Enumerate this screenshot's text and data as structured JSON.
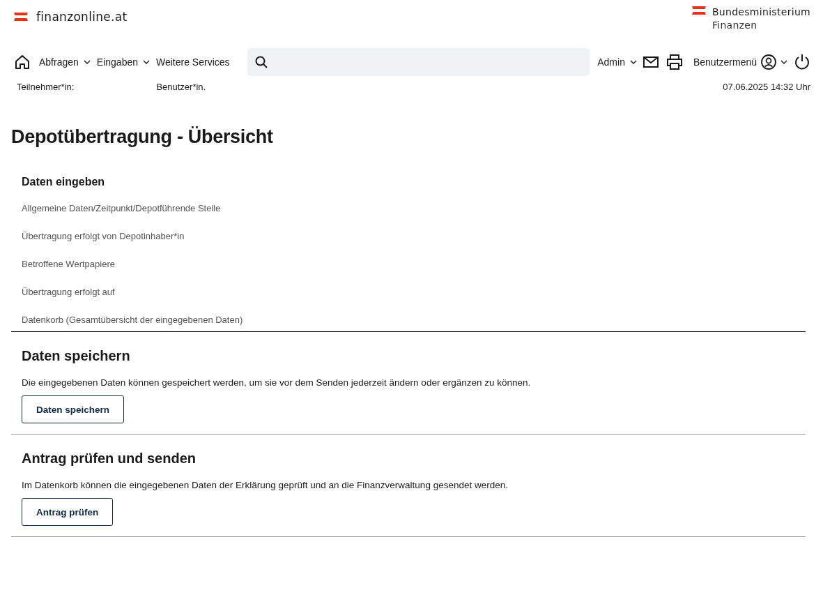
{
  "header": {
    "logo_text": "finanzonline.at",
    "ministry": [
      "Bundesministerium",
      "Finanzen"
    ]
  },
  "nav": {
    "menus": [
      {
        "label": "Abfragen",
        "dropdown": true
      },
      {
        "label": "Eingaben",
        "dropdown": true
      },
      {
        "label": "Weitere Services",
        "dropdown": false
      }
    ],
    "admin": {
      "label": "Admin",
      "dropdown": true
    },
    "user_menu": {
      "label": "Benutzermenü",
      "dropdown": true
    }
  },
  "info": {
    "participant": "Teilnehmer*in:",
    "user": "Benutzer*in.",
    "datetime": "07.06.2025 14:32 Uhr"
  },
  "title": "Depotübertragung - Übersicht",
  "data_entry": {
    "heading": "Daten eingeben",
    "links": [
      "Allgemeine Daten/Zeitpunkt/Depotführende Stelle",
      "Übertragung erfolgt von Depotinhaber*in",
      "Betroffene Wertpapiere",
      "Übertragung erfolgt auf",
      "Datenkorb (Gesamtübersicht der eingegebenen Daten)"
    ]
  },
  "sections": [
    {
      "heading": "Daten speichern",
      "text": "Die eingegebenen Daten können gespeichert werden, um sie vor dem Senden jederzeit ändern oder ergänzen zu können.",
      "button": "Daten speichern"
    },
    {
      "heading": "Antrag prüfen und senden",
      "text": "Im Datenkorb können die eingegebenen Daten der Erklärung geprüft und an die Finanzverwaltung gesendet werden.",
      "button": "Antrag prüfen"
    }
  ]
}
